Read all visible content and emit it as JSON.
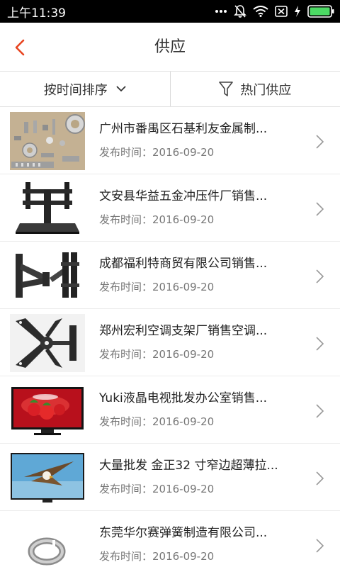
{
  "status_bar": {
    "time": "上午11:39"
  },
  "header": {
    "title": "供应"
  },
  "filters": {
    "sort_label": "按时间排序",
    "hot_label": "热门供应"
  },
  "list": [
    {
      "title": "广州市番禺区石基利友金属制...",
      "date_label": "发布时间：2016-09-20",
      "image": "metal-parts"
    },
    {
      "title": "文安县华益五金冲压件厂销售...",
      "date_label": "发布时间：2016-09-20",
      "image": "tv-stand"
    },
    {
      "title": "成都福利特商贸有限公司销售...",
      "date_label": "发布时间：2016-09-20",
      "image": "swing-arm-mount"
    },
    {
      "title": "郑州宏利空调支架厂销售空调...",
      "date_label": "发布时间：2016-09-20",
      "image": "wall-mount"
    },
    {
      "title": "Yuki液晶电视批发办公室销售...",
      "date_label": "发布时间：2016-09-20",
      "image": "tv-strawberries"
    },
    {
      "title": "大量批发 金正32 寸窄边超薄拉...",
      "date_label": "发布时间：2016-09-20",
      "image": "tv-eagle"
    },
    {
      "title": "东莞华尔赛弹簧制造有限公司...",
      "date_label": "发布时间：2016-09-20",
      "image": "spring-washer"
    }
  ],
  "colors": {
    "accent": "#e8441f",
    "status_bar_bg": "#000000",
    "battery_fill": "#4cd964"
  }
}
